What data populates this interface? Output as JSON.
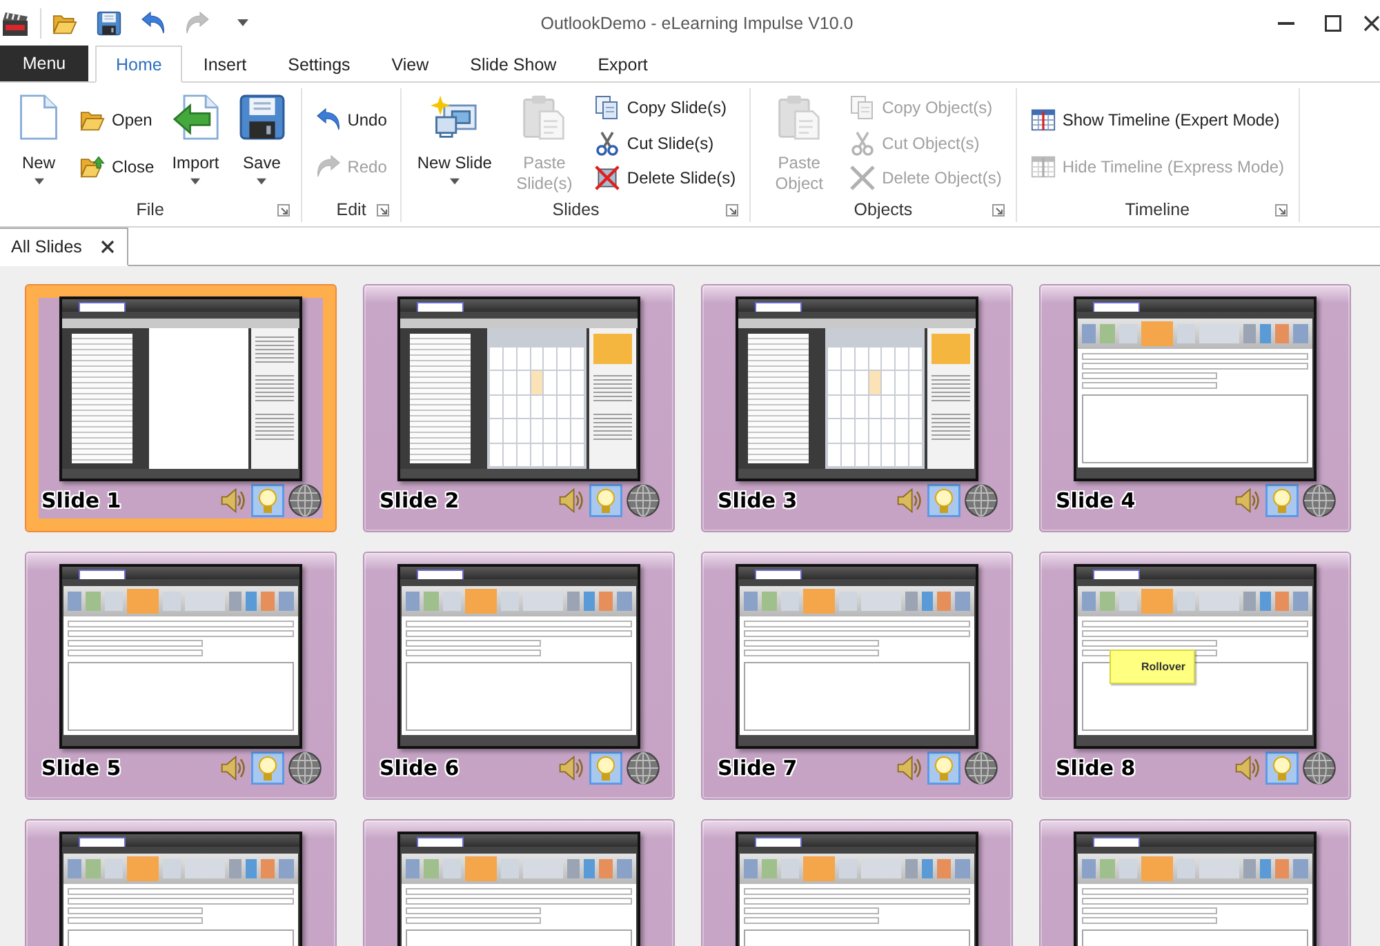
{
  "window": {
    "title": "OutlookDemo - eLearning Impulse V10.0"
  },
  "quick_access": [
    {
      "disabled": false
    },
    {
      "disabled": false
    },
    {
      "disabled": false
    },
    {
      "disabled": true
    }
  ],
  "menu_button": {
    "label": "Menu"
  },
  "tabs": [
    {
      "label": "Home",
      "selected": true
    },
    {
      "label": "Insert",
      "selected": false
    },
    {
      "label": "Settings",
      "selected": false
    },
    {
      "label": "View",
      "selected": false
    },
    {
      "label": "Slide Show",
      "selected": false
    },
    {
      "label": "Export",
      "selected": false
    }
  ],
  "ribbon": {
    "groups": [
      {
        "name": "File",
        "launcher": true,
        "commands": [
          {
            "label": "New",
            "kind": "large",
            "dropdown": true,
            "disabled": false
          },
          {
            "label": "Open",
            "kind": "small",
            "disabled": false
          },
          {
            "label": "Close",
            "kind": "small",
            "disabled": false
          },
          {
            "label": "Import",
            "kind": "large",
            "dropdown": true,
            "disabled": false
          },
          {
            "label": "Save",
            "kind": "large",
            "dropdown": true,
            "disabled": false
          }
        ]
      },
      {
        "name": "Edit",
        "launcher": true,
        "commands": [
          {
            "label": "Undo",
            "kind": "small",
            "disabled": false
          },
          {
            "label": "Redo",
            "kind": "small",
            "disabled": true
          }
        ]
      },
      {
        "name": "Slides",
        "launcher": true,
        "commands": [
          {
            "label": "New Slide",
            "kind": "large",
            "dropdown": true,
            "disabled": false
          },
          {
            "label": "Paste Slide(s)",
            "kind": "large",
            "dropdown": false,
            "disabled": true
          },
          {
            "label": "Copy Slide(s)",
            "kind": "small",
            "disabled": false
          },
          {
            "label": "Cut Slide(s)",
            "kind": "small",
            "disabled": false
          },
          {
            "label": "Delete Slide(s)",
            "kind": "small",
            "disabled": false
          }
        ]
      },
      {
        "name": "Objects",
        "launcher": true,
        "commands": [
          {
            "label": "Paste Object",
            "kind": "large",
            "dropdown": false,
            "disabled": true
          },
          {
            "label": "Copy Object(s)",
            "kind": "small",
            "disabled": true
          },
          {
            "label": "Cut Object(s)",
            "kind": "small",
            "disabled": true
          },
          {
            "label": "Delete Object(s)",
            "kind": "small",
            "disabled": true
          }
        ]
      },
      {
        "name": "Timeline",
        "launcher": true,
        "commands": [
          {
            "label": "Show Timeline (Expert Mode)",
            "kind": "small",
            "disabled": false
          },
          {
            "label": "Hide Timeline (Express Mode)",
            "kind": "small",
            "disabled": true
          }
        ]
      }
    ]
  },
  "document_tabs": [
    {
      "label": "All Slides",
      "selected": true,
      "closable": true
    }
  ],
  "slides": [
    {
      "label": "Slide 1",
      "selected": true,
      "kind": "mail",
      "hint_on": true
    },
    {
      "label": "Slide 2",
      "selected": false,
      "kind": "calendar",
      "hint_on": true
    },
    {
      "label": "Slide 3",
      "selected": false,
      "kind": "calendar",
      "hint_on": true
    },
    {
      "label": "Slide 4",
      "selected": false,
      "kind": "form",
      "hint_on": true
    },
    {
      "label": "Slide 5",
      "selected": false,
      "kind": "form",
      "hint_on": true
    },
    {
      "label": "Slide 6",
      "selected": false,
      "kind": "form",
      "hint_on": true
    },
    {
      "label": "Slide 7",
      "selected": false,
      "kind": "form",
      "hint_on": true
    },
    {
      "label": "Slide 8",
      "selected": false,
      "kind": "form",
      "hint_on": true,
      "callout": "Rollover"
    },
    {
      "selected": false,
      "kind": "form"
    },
    {
      "selected": false,
      "kind": "form"
    },
    {
      "selected": false,
      "kind": "form"
    },
    {
      "selected": false,
      "kind": "form"
    }
  ]
}
